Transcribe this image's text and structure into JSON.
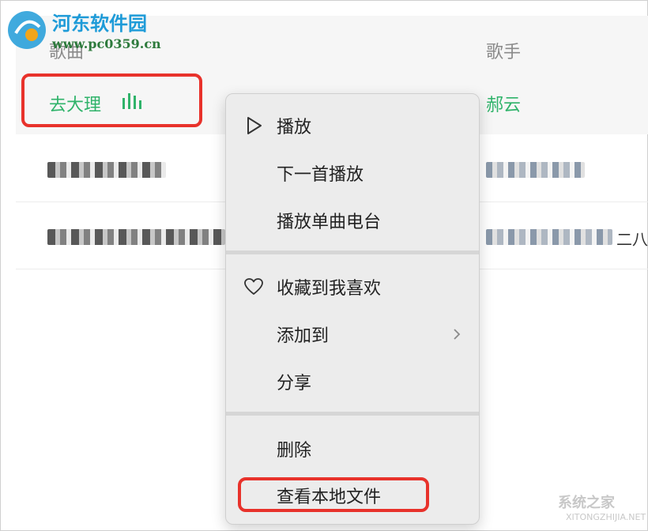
{
  "table": {
    "columns": {
      "song": "歌曲",
      "singer": "歌手"
    },
    "playing_row": {
      "title": "去大理",
      "artist": "郝云"
    },
    "row3_overflow": "二八"
  },
  "context_menu": {
    "items": [
      {
        "label": "播放",
        "icon": "play-icon"
      },
      {
        "label": "下一首播放"
      },
      {
        "label": "播放单曲电台"
      },
      {
        "label": "收藏到我喜欢",
        "icon": "heart-icon"
      },
      {
        "label": "添加到",
        "icon": "chevron-right-icon"
      },
      {
        "label": "分享"
      },
      {
        "label": "删除"
      },
      {
        "label": "查看本地文件"
      }
    ]
  },
  "watermark": {
    "name": "河东软件园",
    "url": "www.pc0359.cn",
    "bottom": "系统之家",
    "bottom_url": "XITONGZHIJIA.NET"
  },
  "colors": {
    "accent_green": "#2fb36a",
    "highlight_red": "#e8322b"
  }
}
